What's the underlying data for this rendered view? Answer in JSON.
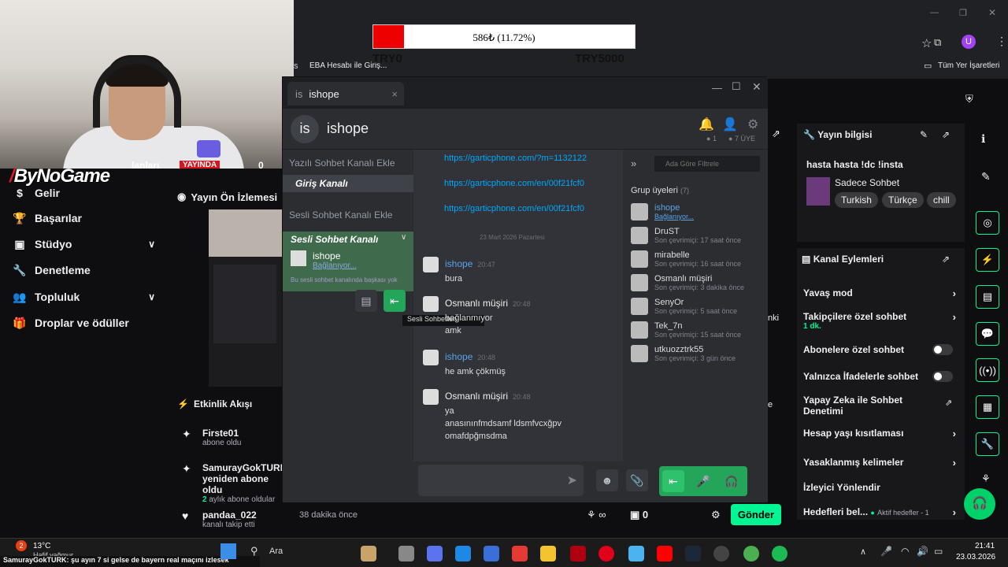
{
  "progress": {
    "text": "586₺ (11.72%)",
    "fraction": 0.1172,
    "left_label": "TRY0",
    "right_label": "TRY5000"
  },
  "browser": {
    "bookmark1": "EBA Hesabı ile Giriş...",
    "bookmarks_all": "Tüm Yer İşaretleri",
    "profile_letter": "U",
    "left_frag": "s"
  },
  "webcam": {
    "logo": "ByNoGame",
    "live_badge": "YAYINDA",
    "frag1": "lanları",
    "frag2": "0"
  },
  "left_nav": {
    "items": [
      {
        "label": "Gelir"
      },
      {
        "label": "Başarılar"
      },
      {
        "label": "Stüdyo"
      },
      {
        "label": "Denetleme"
      },
      {
        "label": "Topluluk"
      },
      {
        "label": "Droplar ve ödüller"
      }
    ]
  },
  "preview": {
    "title": "Yayın Ön İzlemesi"
  },
  "activity": {
    "title": "Etkinlik Akışı",
    "items": [
      {
        "name": "Firste01",
        "sub": "abone oldu"
      },
      {
        "name": "SamurayGokTURK yeniden abone oldu",
        "sub_count": "2",
        "sub": "aylık abone oldular"
      },
      {
        "name": "pandaa_022",
        "sub": "kanalı takip etti",
        "time": "38 dakika önce"
      }
    ]
  },
  "discord": {
    "tab": "ishope",
    "server_initials": "is",
    "server_name": "ishope",
    "notif_count": "1",
    "member_count": "7 ÜYE",
    "channels": {
      "text_add": "Yazılı Sohbet Kanalı Ekle",
      "login": "Giriş Kanalı",
      "voice_add": "Sesli Sohbet Kanalı Ekle",
      "voice_channel": "Sesli Sohbet Kanalı",
      "voice_user": "ishope",
      "voice_status": "Bağlanıyor...",
      "voice_note": "Bu sesli sohbet kanalında başkası yok",
      "tooltip": "Sesli Sohbetten"
    },
    "links": [
      "https://garticphone.com/?m=1132122",
      "https://garticphone.com/en/00f21fcf0",
      "https://garticphone.com/en/00f21fcf0"
    ],
    "date_sep": "23 Mart 2026 Pazartesi",
    "messages": [
      {
        "user": "ishope",
        "time": "20:47",
        "body": "bura"
      },
      {
        "user": "Osmanlı müşiri",
        "time": "20:48",
        "body": "bağlanmıyor\namk"
      },
      {
        "user": "ishope",
        "time": "20:48",
        "body": "he amk çökmüş"
      },
      {
        "user": "Osmanlı müşiri",
        "time": "20:48",
        "body": "ya\nanasınınfmdsamf ldsmfvcxğpv\nomafdpğmsdma"
      }
    ],
    "filter_placeholder": "Ada Göre Filtrele",
    "group_title": "Grup üyeleri",
    "group_count": "(7)",
    "members": [
      {
        "name": "ishope",
        "status": "Bağlanıyor..."
      },
      {
        "name": "DruST",
        "status": "Son çevrimiçi: 17 saat önce"
      },
      {
        "name": "mirabelle",
        "status": "Son çevrimiçi: 16 saat önce"
      },
      {
        "name": "Osmanlı müşiri",
        "status": "Son çevrimiçi: 3 dakika önce"
      },
      {
        "name": "SenyOr",
        "status": "Son çevrimiçi: 5 saat önce"
      },
      {
        "name": "Tek_7n",
        "status": "Son çevrimiçi: 15 saat önce"
      },
      {
        "name": "utkuozztrk55",
        "status": "Son çevrimiçi: 3 gün önce"
      }
    ]
  },
  "stream_info": {
    "title": "Yayın bilgisi",
    "stream_title": "hasta hasta !dc !insta",
    "category": "Sadece Sohbet",
    "tags": [
      "Turkish",
      "Türkçe",
      "chill"
    ]
  },
  "channel_actions": {
    "title": "Kanal Eylemleri",
    "rows": [
      {
        "label": "Yavaş mod"
      },
      {
        "label": "Takipçilere özel sohbet",
        "sub": "1 dk."
      },
      {
        "label": "Abonelere özel sohbet"
      },
      {
        "label": "Yalnızca İfadelerle sohbet"
      },
      {
        "label": "Yapay Zeka ile Sohbet Denetimi"
      },
      {
        "label": "Hesap yaşı kısıtlaması"
      },
      {
        "label": "Yasaklanmış kelimeler"
      },
      {
        "label": "İzleyici Yönlendir"
      },
      {
        "label": "Hedefleri bel...",
        "extra": "Aktif hedefler - 1"
      }
    ]
  },
  "chat_bar": {
    "count": "0",
    "send": "Gönder",
    "frag_nki": "nki",
    "frag_e": "e"
  },
  "taskbar": {
    "temp": "13°C",
    "weather": "Hafif yağmur",
    "badge": "2",
    "search": "Ara",
    "time": "21:41",
    "date": "23.03.2026",
    "ticker": "SamurayGokTURK: şu ayın 7 si gelse de bayern real maçını izlesek"
  },
  "colors": {
    "accent": "#00f593",
    "progress_fill": "#ee0000",
    "discord_green": "#23a55a",
    "link": "#00a8fc"
  }
}
